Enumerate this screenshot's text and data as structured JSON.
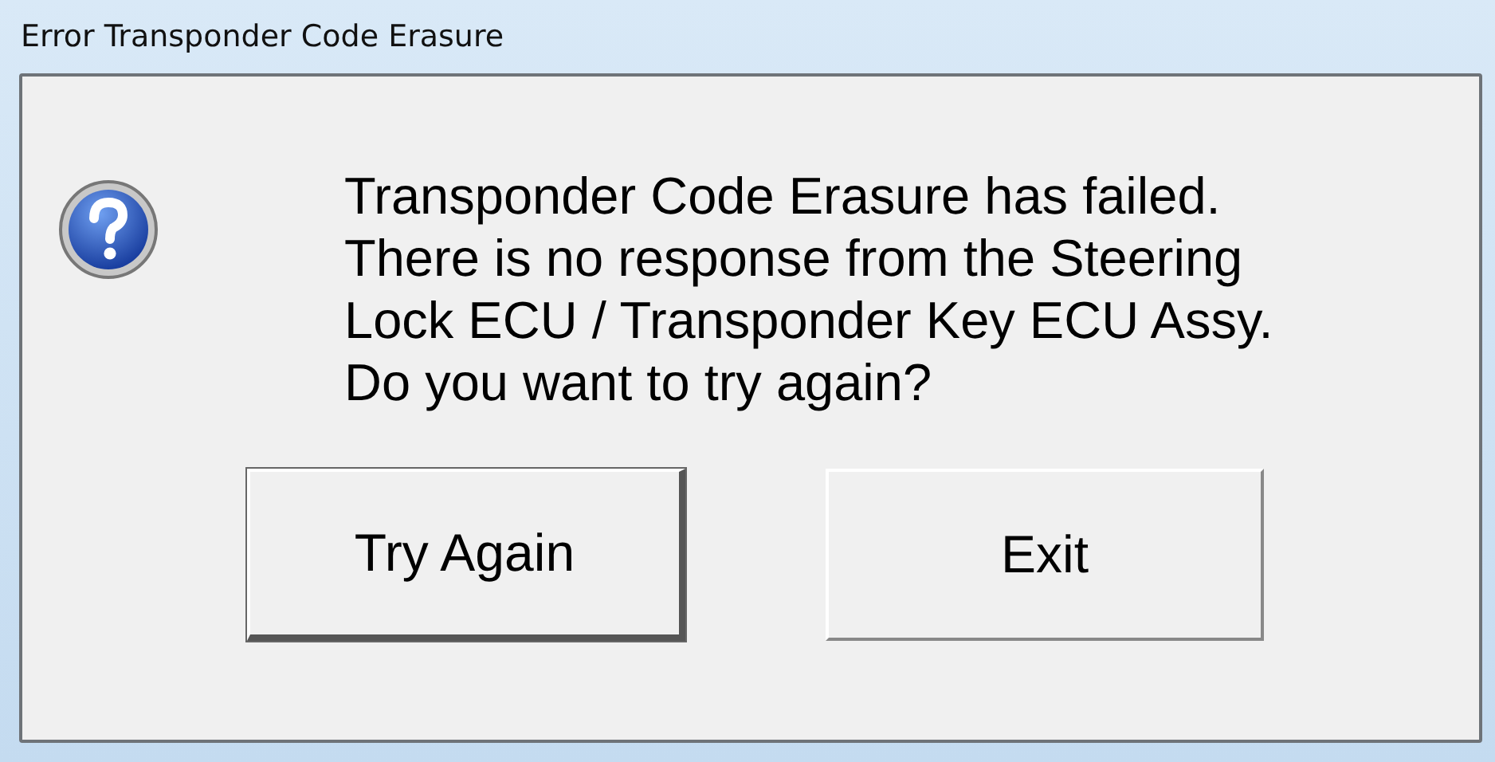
{
  "window": {
    "title": "Error Transponder Code Erasure"
  },
  "message": {
    "lines": [
      "Transponder Code Erasure has failed.",
      "There is no response from the Steering",
      "Lock ECU / Transponder Key ECU Assy.",
      "Do you want to try again?"
    ]
  },
  "buttons": [
    {
      "label": "Try Again",
      "default": true
    },
    {
      "label": "Exit",
      "default": false
    }
  ]
}
